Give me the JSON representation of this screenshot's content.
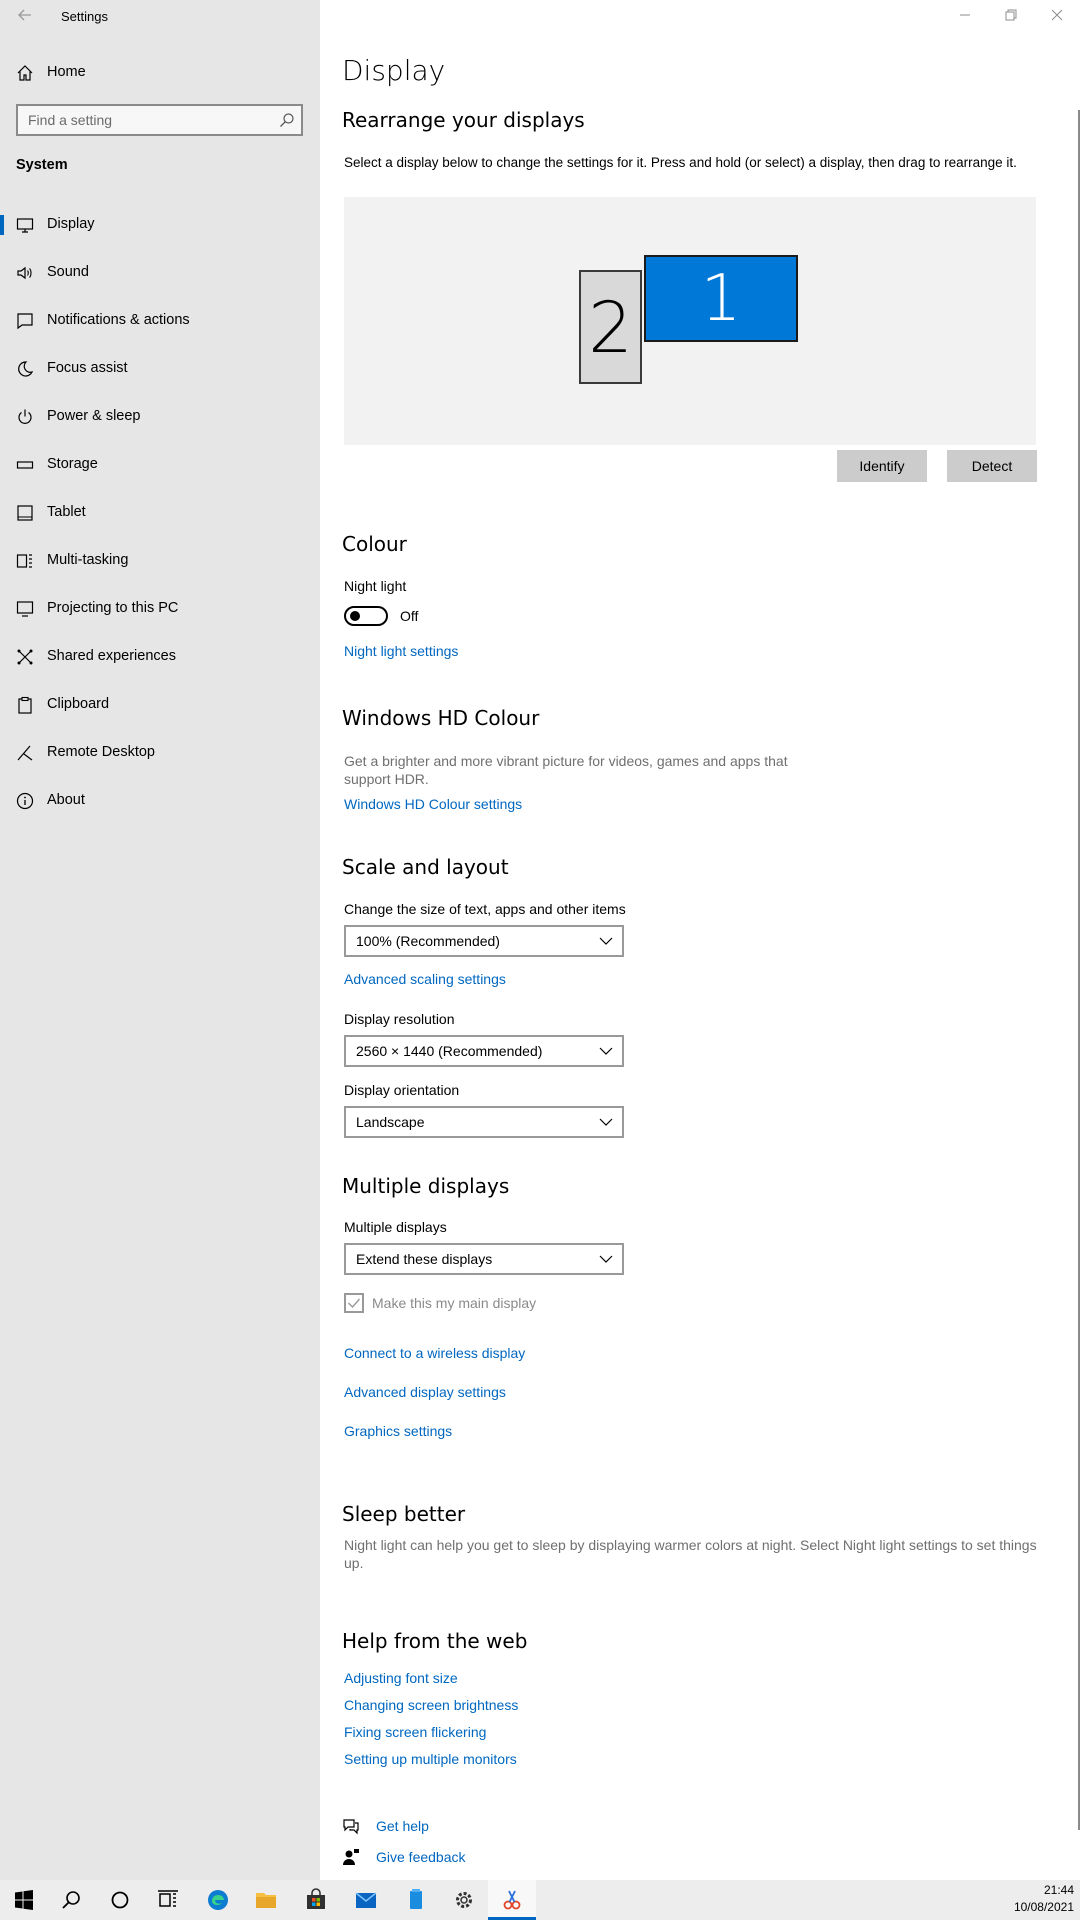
{
  "app": {
    "title": "Settings"
  },
  "sidebar": {
    "home_label": "Home",
    "search_placeholder": "Find a setting",
    "section": "System",
    "items": [
      {
        "label": "Display",
        "icon": "monitor-icon"
      },
      {
        "label": "Sound",
        "icon": "speaker-icon"
      },
      {
        "label": "Notifications & actions",
        "icon": "notification-icon"
      },
      {
        "label": "Focus assist",
        "icon": "moon-icon"
      },
      {
        "label": "Power & sleep",
        "icon": "power-icon"
      },
      {
        "label": "Storage",
        "icon": "storage-icon"
      },
      {
        "label": "Tablet",
        "icon": "tablet-icon"
      },
      {
        "label": "Multi-tasking",
        "icon": "multitasking-icon"
      },
      {
        "label": "Projecting to this PC",
        "icon": "projecting-icon"
      },
      {
        "label": "Shared experiences",
        "icon": "shared-icon"
      },
      {
        "label": "Clipboard",
        "icon": "clipboard-icon"
      },
      {
        "label": "Remote Desktop",
        "icon": "remote-icon"
      },
      {
        "label": "About",
        "icon": "info-icon"
      }
    ]
  },
  "main": {
    "title": "Display",
    "rearrange": {
      "heading": "Rearrange your displays",
      "description": "Select a display below to change the settings for it. Press and hold (or select) a display, then drag to rearrange it.",
      "monitor1": "1",
      "monitor2": "2",
      "identify": "Identify",
      "detect": "Detect"
    },
    "colour": {
      "heading": "Colour",
      "night_light_label": "Night light",
      "night_light_state": "Off",
      "night_light_link": "Night light settings"
    },
    "hdr": {
      "heading": "Windows HD Colour",
      "description_line1": "Get a brighter and more vibrant picture for videos, games and apps that",
      "description_line2": "support HDR.",
      "link": "Windows HD Colour settings"
    },
    "scale": {
      "heading": "Scale and layout",
      "size_label": "Change the size of text, apps and other items",
      "size_value": "100% (Recommended)",
      "advanced_link": "Advanced scaling settings",
      "resolution_label": "Display resolution",
      "resolution_value": "2560 × 1440 (Recommended)",
      "orientation_label": "Display orientation",
      "orientation_value": "Landscape"
    },
    "multiple": {
      "heading": "Multiple displays",
      "label": "Multiple displays",
      "value": "Extend these displays",
      "main_display_label": "Make this my main display",
      "links": [
        "Connect to a wireless display",
        "Advanced display settings",
        "Graphics settings"
      ]
    },
    "sleep": {
      "heading": "Sleep better",
      "line1": "Night light can help you get to sleep by displaying warmer colors at night. Select Night light settings to set things",
      "line2": "up."
    },
    "help": {
      "heading": "Help from the web",
      "links": [
        "Adjusting font size",
        "Changing screen brightness",
        "Fixing screen flickering",
        "Setting up multiple monitors"
      ]
    },
    "footer": {
      "get_help": "Get help",
      "give_feedback": "Give feedback"
    }
  },
  "taskbar": {
    "time": "21:44",
    "date": "10/08/2021"
  },
  "colors": {
    "accent": "#0067c0",
    "monitor": "#0078d7"
  }
}
